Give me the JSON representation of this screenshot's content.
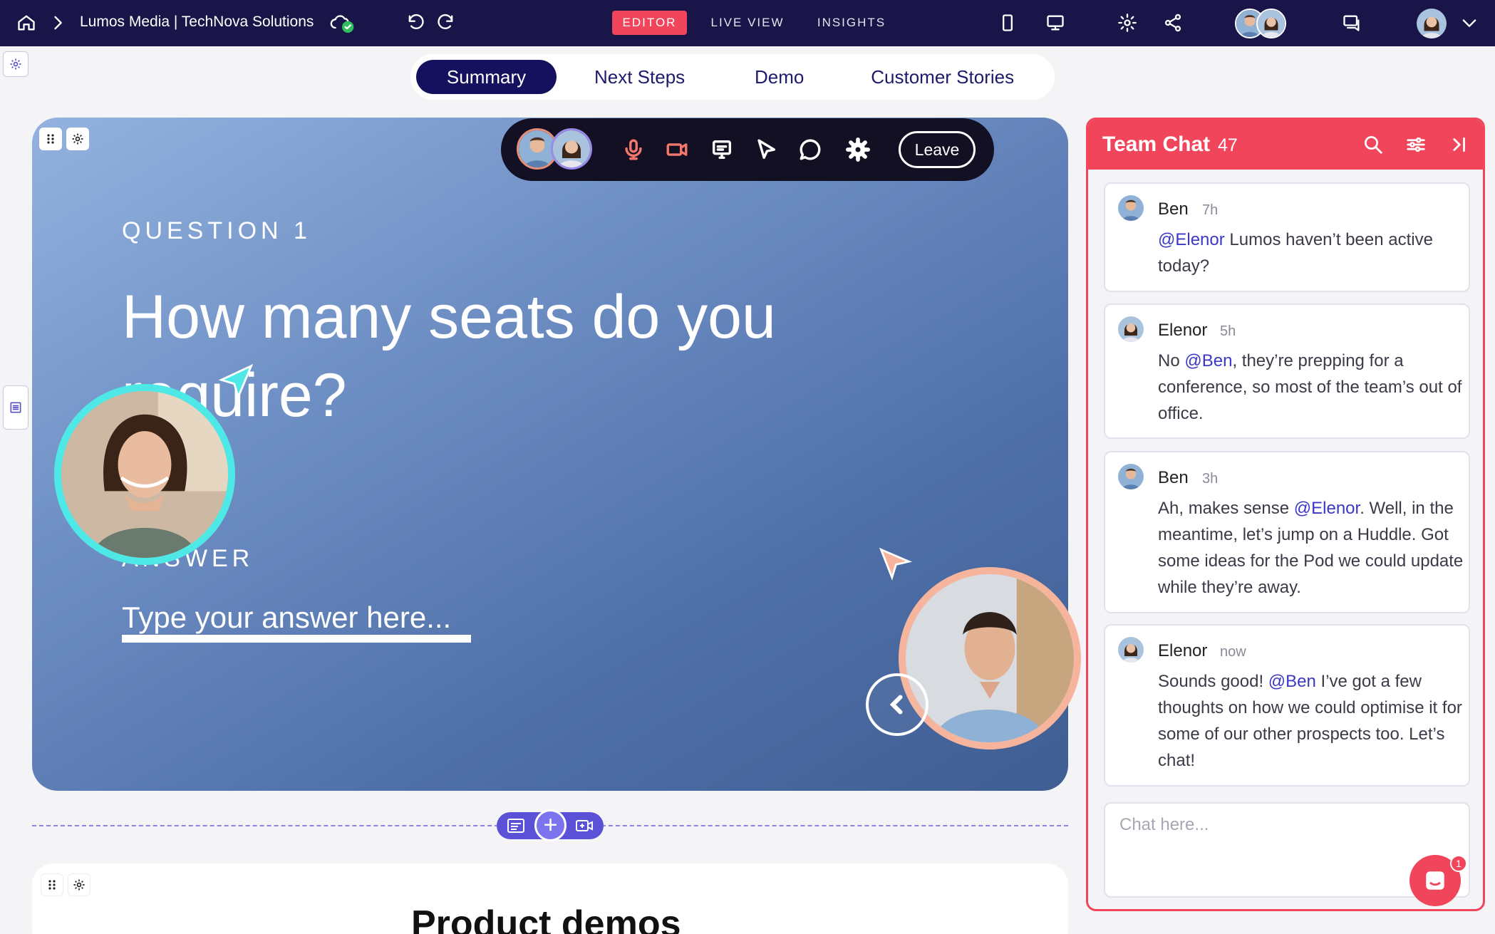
{
  "topbar": {
    "breadcrumb": "Lumos Media | TechNova Solutions",
    "modes": [
      {
        "label": "EDITOR",
        "active": true
      },
      {
        "label": "LIVE VIEW",
        "active": false
      },
      {
        "label": "INSIGHTS",
        "active": false
      }
    ],
    "icons": [
      "home-icon",
      "chevron-right-icon",
      "cloud-check-icon",
      "undo-icon",
      "redo-icon",
      "mobile-icon",
      "desktop-icon",
      "gear-icon",
      "share-icon",
      "chat-bubbles-icon",
      "chevron-down-icon"
    ]
  },
  "tabs": [
    {
      "label": "Summary",
      "active": true
    },
    {
      "label": "Next Steps",
      "active": false
    },
    {
      "label": "Demo",
      "active": false
    },
    {
      "label": "Customer Stories",
      "active": false
    }
  ],
  "slide": {
    "question_label": "QUESTION 1",
    "question_text": "How many seats do you require?",
    "answer_label": "ANSWER",
    "answer_placeholder": "Type your answer here...",
    "huddle": {
      "leave_label": "Leave",
      "icons": [
        "microphone-icon",
        "camera-icon",
        "screen-share-icon",
        "pointer-icon",
        "comment-icon",
        "settings-icon"
      ]
    }
  },
  "lower_card": {
    "title": "Product demos"
  },
  "chat": {
    "title": "Team Chat",
    "count": "47",
    "messages": [
      {
        "name": "Ben",
        "time": "7h",
        "parts": [
          {
            "mention": "@Elenor"
          },
          {
            "text": " Lumos haven’t been active today?"
          }
        ]
      },
      {
        "name": "Elenor",
        "time": "5h",
        "parts": [
          {
            "text": "No "
          },
          {
            "mention": "@Ben"
          },
          {
            "text": ", they’re prepping for a conference, so most of the team’s out of office."
          }
        ]
      },
      {
        "name": "Ben",
        "time": "3h",
        "parts": [
          {
            "text": "Ah, makes sense "
          },
          {
            "mention": "@Elenor"
          },
          {
            "text": ". Well, in the meantime, let’s jump on a Huddle. Got some ideas for the Pod we could update while they’re away."
          }
        ]
      },
      {
        "name": "Elenor",
        "time": "now",
        "parts": [
          {
            "text": "Sounds good! "
          },
          {
            "mention": "@Ben"
          },
          {
            "text": "  I’ve got a few thoughts on how we could optimise it for some of our other prospects too. Let’s chat!"
          }
        ]
      }
    ],
    "input_placeholder": "Chat here...",
    "fab_badge": "1"
  },
  "colors": {
    "topbar": "#191548",
    "accent": "#f0455b",
    "tab_active": "#15115e",
    "mention": "#3c37c6",
    "bubble_left_ring": "#4ee9e6",
    "bubble_right_ring": "#f6b49c"
  }
}
